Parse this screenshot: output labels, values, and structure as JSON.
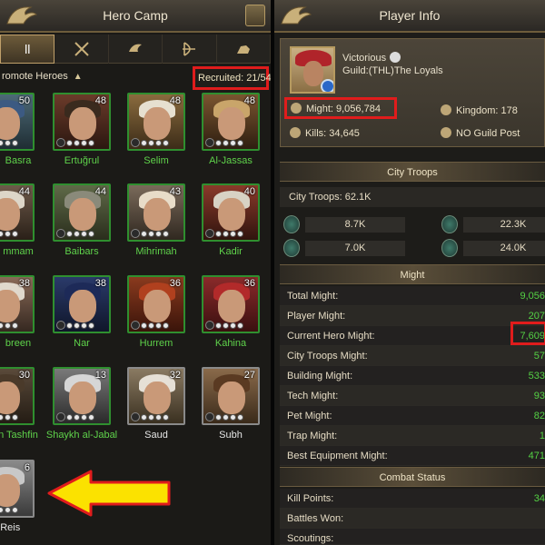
{
  "left_panel": {
    "title": "Hero Camp",
    "tabs": [
      {
        "label": "ll",
        "icon": "all-icon",
        "active": true
      },
      {
        "label": "",
        "icon": "swords-icon"
      },
      {
        "label": "",
        "icon": "eagle-icon"
      },
      {
        "label": "",
        "icon": "bow-icon"
      },
      {
        "label": "",
        "icon": "cavalry-icon"
      }
    ],
    "promote_label": "romote Heroes",
    "recruited": "Recruited: 21/54",
    "heroes": [
      {
        "name": "Basra",
        "level": "50"
      },
      {
        "name": "Ertuğrul",
        "level": "48"
      },
      {
        "name": "Selim",
        "level": "48"
      },
      {
        "name": "Al-Jassas",
        "level": "48"
      },
      {
        "name": "mmam",
        "level": "44"
      },
      {
        "name": "Baibars",
        "level": "44"
      },
      {
        "name": "Mihrimah",
        "level": "43"
      },
      {
        "name": "Kadir",
        "level": "40"
      },
      {
        "name": "breen",
        "level": "38"
      },
      {
        "name": "Nar",
        "level": "38"
      },
      {
        "name": "Hurrem",
        "level": "36"
      },
      {
        "name": "Kahina",
        "level": "36"
      },
      {
        "name": "n Tashfin",
        "level": "30"
      },
      {
        "name": "Shaykh al-Jabal",
        "level": "13"
      },
      {
        "name": "Saud",
        "level": "32"
      },
      {
        "name": "Subh",
        "level": "27"
      },
      {
        "name": "at Reis",
        "level": "6"
      }
    ]
  },
  "right_panel": {
    "title": "Player Info",
    "player_name": "Victorious",
    "guild": "Guild:(THL)The Loyals",
    "might": "Might: 9,056,784",
    "kingdom": "Kingdom: 178",
    "kills": "Kills: 34,645",
    "guild_post": "NO Guild Post",
    "city_troops_header": "City Troops",
    "city_troops_total": "City Troops: 62.1K",
    "troops": [
      "8.7K",
      "22.3K",
      "7.0K",
      "24.0K"
    ],
    "might_header": "Might",
    "might_rows": [
      {
        "label": "Total Might:",
        "value": "9,056"
      },
      {
        "label": "Player Might:",
        "value": "207"
      },
      {
        "label": "Current Hero Might:",
        "value": "7,609"
      },
      {
        "label": "City Troops Might:",
        "value": "57"
      },
      {
        "label": "Building Might:",
        "value": "533"
      },
      {
        "label": "Tech Might:",
        "value": "93"
      },
      {
        "label": "Pet Might:",
        "value": "82"
      },
      {
        "label": "Trap Might:",
        "value": "1"
      },
      {
        "label": "Best Equipment Might:",
        "value": "471"
      }
    ],
    "combat_header": "Combat Status",
    "combat_rows": [
      {
        "label": "Kill Points:",
        "value": "34"
      },
      {
        "label": "Battles Won:",
        "value": ""
      },
      {
        "label": "Scoutings:",
        "value": ""
      }
    ]
  }
}
